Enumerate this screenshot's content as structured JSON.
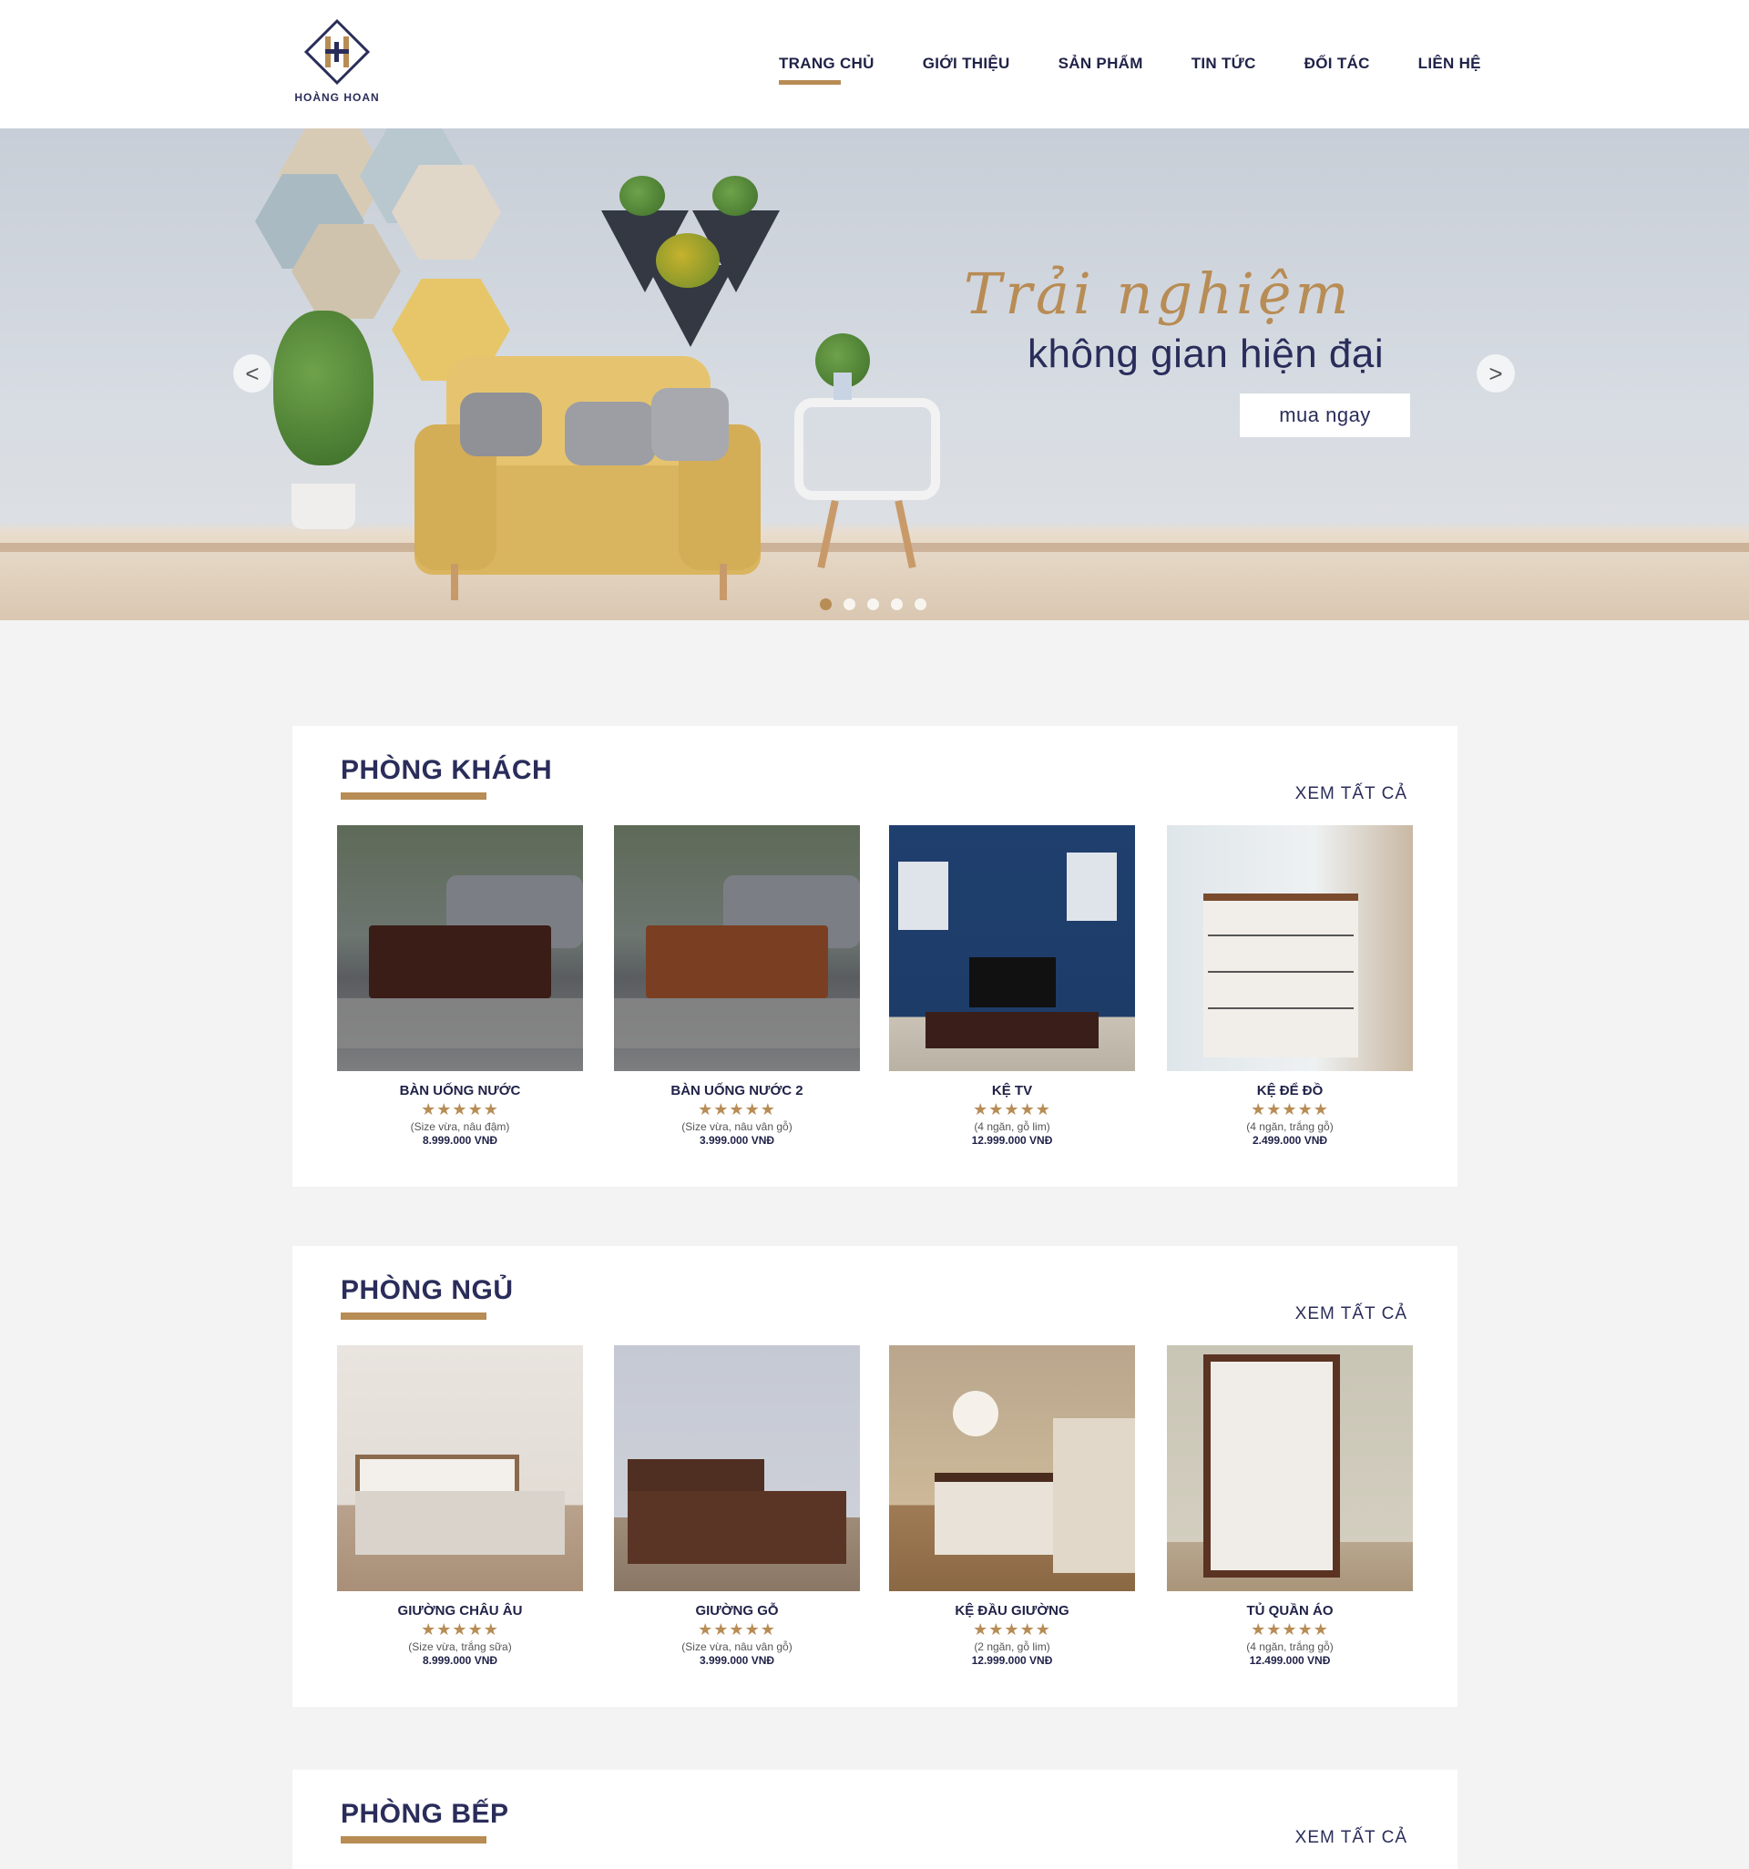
{
  "brand": {
    "name": "HOÀNG HOAN",
    "accent": "#b88c55",
    "navy": "#2a2d5a"
  },
  "nav": {
    "items": [
      {
        "label": "TRANG CHỦ",
        "active": true
      },
      {
        "label": "GIỚI THIỆU"
      },
      {
        "label": "SẢN PHẨM"
      },
      {
        "label": "TIN TỨC"
      },
      {
        "label": "ĐỐI TÁC"
      },
      {
        "label": "LIÊN HỆ"
      }
    ]
  },
  "hero": {
    "script_text": "Trải nghiệm",
    "title": "không gian hiện đại",
    "button": "mua ngay",
    "prev": "<",
    "next": ">",
    "slide_count": 5,
    "active_slide": 1
  },
  "sections": [
    {
      "title": "PHÒNG KHÁCH",
      "view_all": "XEM TẤT CẢ",
      "products": [
        {
          "name": "BÀN UỐNG NƯỚC",
          "stars": "★★★★★",
          "desc": "(Size vừa, nâu đậm)",
          "price": "8.999.000 VNĐ"
        },
        {
          "name": "BÀN UỐNG NƯỚC 2",
          "stars": "★★★★★",
          "desc": "(Size vừa, nâu vân gỗ)",
          "price": "3.999.000 VNĐ"
        },
        {
          "name": "KỆ TV",
          "stars": "★★★★★",
          "desc": "(4 ngăn, gỗ lim)",
          "price": "12.999.000 VNĐ"
        },
        {
          "name": "KỆ ĐỂ ĐỒ",
          "stars": "★★★★★",
          "desc": "(4 ngăn, trắng gỗ)",
          "price": "2.499.000 VNĐ"
        }
      ]
    },
    {
      "title": "PHÒNG NGỦ",
      "view_all": "XEM TẤT CẢ",
      "products": [
        {
          "name": "GIƯỜNG CHÂU ÂU",
          "stars": "★★★★★",
          "desc": "(Size vừa, trắng sữa)",
          "price": "8.999.000 VNĐ"
        },
        {
          "name": "GIƯỜNG GỖ",
          "stars": "★★★★★",
          "desc": "(Size vừa, nâu vân gỗ)",
          "price": "3.999.000 VNĐ"
        },
        {
          "name": "KỆ ĐẦU GIƯỜNG",
          "stars": "★★★★★",
          "desc": "(2 ngăn, gỗ lim)",
          "price": "12.999.000 VNĐ"
        },
        {
          "name": "TỦ QUẦN ÁO",
          "stars": "★★★★★",
          "desc": "(4 ngăn, trắng gỗ)",
          "price": "12.499.000 VNĐ"
        }
      ]
    },
    {
      "title": "PHÒNG BẾP",
      "view_all": "XEM TẤT CẢ",
      "products": []
    }
  ]
}
